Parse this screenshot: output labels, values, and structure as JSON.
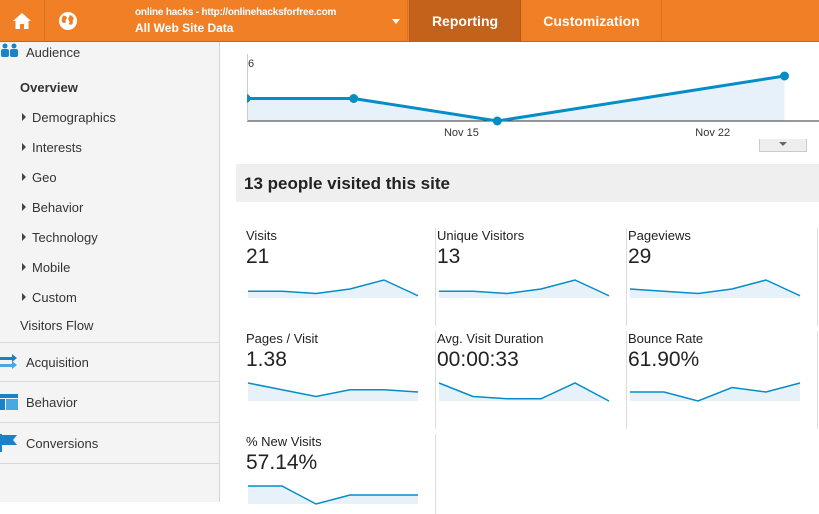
{
  "topbar": {
    "account_url": "online hacks - http://onlinehacksforfree.com",
    "view_name": "All Web Site Data",
    "tabs": [
      {
        "label": "Reporting",
        "active": true
      },
      {
        "label": "Customization",
        "active": false
      }
    ],
    "home_icon": "home-icon",
    "globe_icon": "globe-icon"
  },
  "sidebar": {
    "audience": {
      "label": "Audience",
      "icon": "audience-people-icon"
    },
    "overview": "Overview",
    "items": [
      "Demographics",
      "Interests",
      "Geo",
      "Behavior",
      "Technology",
      "Mobile",
      "Custom"
    ],
    "visitors_flow": "Visitors Flow",
    "sections": [
      {
        "label": "Acquisition",
        "icon": "acquisition-arrows-icon"
      },
      {
        "label": "Behavior",
        "icon": "behavior-layout-icon"
      },
      {
        "label": "Conversions",
        "icon": "conversions-flag-icon"
      }
    ]
  },
  "chart_data": {
    "type": "area",
    "y_tick_label": "6",
    "x_tick_labels": [
      "Nov 15",
      "Nov 22"
    ],
    "points": [
      {
        "x": "Nov 9",
        "y": 3
      },
      {
        "x": "Nov 12",
        "y": 3
      },
      {
        "x": "Nov 16",
        "y": 0
      },
      {
        "x": "Nov 24",
        "y": 6
      }
    ],
    "grid": false,
    "color": "#058dc7"
  },
  "summary_title": "13 people visited this site",
  "metrics": [
    {
      "label": "Visits",
      "value": "21",
      "spark": [
        3,
        3,
        2,
        4,
        8,
        1
      ]
    },
    {
      "label": "Unique Visitors",
      "value": "13",
      "spark": [
        3,
        3,
        2,
        4,
        8,
        1
      ]
    },
    {
      "label": "Pageviews",
      "value": "29",
      "spark": [
        4,
        3,
        2,
        4,
        8,
        1
      ]
    },
    {
      "label": "Pages / Visit",
      "value": "1.38",
      "spark": [
        8,
        5,
        2,
        5,
        5,
        4
      ]
    },
    {
      "label": "Avg. Visit Duration",
      "value": "00:00:33",
      "spark": [
        8,
        2,
        1,
        1,
        8,
        0
      ]
    },
    {
      "label": "Bounce Rate",
      "value": "61.90%",
      "spark": [
        4,
        4,
        0,
        6,
        4,
        8
      ]
    },
    {
      "label": "% New Visits",
      "value": "57.14%",
      "spark": [
        8,
        8,
        0,
        4,
        4,
        4
      ]
    }
  ],
  "colors": {
    "accent": "#f07f26",
    "active_tab": "#c4611b",
    "line": "#058dc7",
    "fill": "#e6f1f9"
  }
}
